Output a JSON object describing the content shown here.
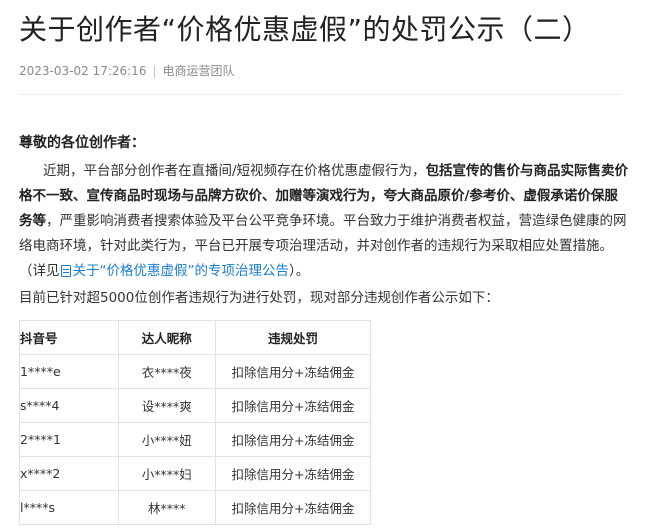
{
  "article": {
    "title": "关于创作者“价格优惠虚假”的处罚公示（二）",
    "date": "2023-03-02 17:26:16",
    "separator": "|",
    "author": "电商运营团队"
  },
  "body": {
    "greeting": "尊敬的各位创作者：",
    "paragraph": {
      "p1": "近期，平台部分创作者在直播间/短视频存在价格优惠虚假行为，",
      "p2": "包括宣传的售价与商品实际售卖价格不一致、宣传商品时现场与品牌方砍价、加赠等演戏行为，夸大商品原价/参考价、虚假承诺价保服务等",
      "p3": "，严重影响消费者搜索体验及平台公平竞争环境。平台致力于维护消费者权益，营造绿色健康的网络电商环境，针对此类行为，平台已开展专项治理活动，并对创作者的违规行为采取相应处置措施。（详见",
      "link_text": "关于“价格优惠虚假”的专项治理公告",
      "p4": "）。"
    },
    "intro": "目前已针对超5000位创作者违规行为进行处罚，现对部分违规创作者公示如下："
  },
  "table": {
    "headers": [
      "抖音号",
      "达人昵称",
      "违规处罚"
    ],
    "rows": [
      [
        "1****e",
        "衣****夜",
        "扣除信用分+冻结佣金"
      ],
      [
        "s****4",
        "设****爽",
        "扣除信用分+冻结佣金"
      ],
      [
        "2****1",
        "小****妞",
        "扣除信用分+冻结佣金"
      ],
      [
        "x****2",
        "小****妇",
        "扣除信用分+冻结佣金"
      ],
      [
        "l****s",
        "林****",
        "扣除信用分+冻结佣金"
      ]
    ]
  },
  "colors": {
    "link": "#1a7fd4",
    "meta": "#8a8a8a",
    "border": "#e2e2e2"
  }
}
